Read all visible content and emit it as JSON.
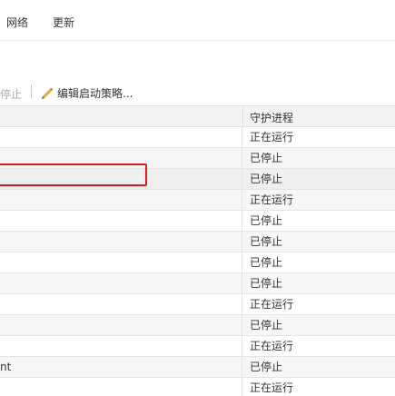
{
  "menu": {
    "tabs": [
      {
        "label": "网络"
      },
      {
        "label": "更新"
      }
    ]
  },
  "toolbar": {
    "stop_label": "停止",
    "edit_label": "编辑启动策略...",
    "edit_icon": "pencil-icon"
  },
  "table": {
    "columns": [
      "",
      "守护进程"
    ],
    "rows": [
      {
        "name": "",
        "status": "正在运行"
      },
      {
        "name": "",
        "status": "已停止"
      },
      {
        "name": "",
        "status": "已停止"
      },
      {
        "name": "",
        "status": "正在运行"
      },
      {
        "name": "",
        "status": "已停止"
      },
      {
        "name": "",
        "status": "已停止"
      },
      {
        "name": "",
        "status": "已停止"
      },
      {
        "name": "",
        "status": "已停止"
      },
      {
        "name": "",
        "status": "正在运行"
      },
      {
        "name": "",
        "status": "已停止"
      },
      {
        "name": "",
        "status": "正在运行"
      },
      {
        "name": "nt",
        "status": "已停止"
      },
      {
        "name": "",
        "status": "正在运行"
      }
    ],
    "selected_row": 2
  },
  "colors": {
    "highlight_border": "#d81e1e",
    "pencil": "#e8a33a"
  }
}
